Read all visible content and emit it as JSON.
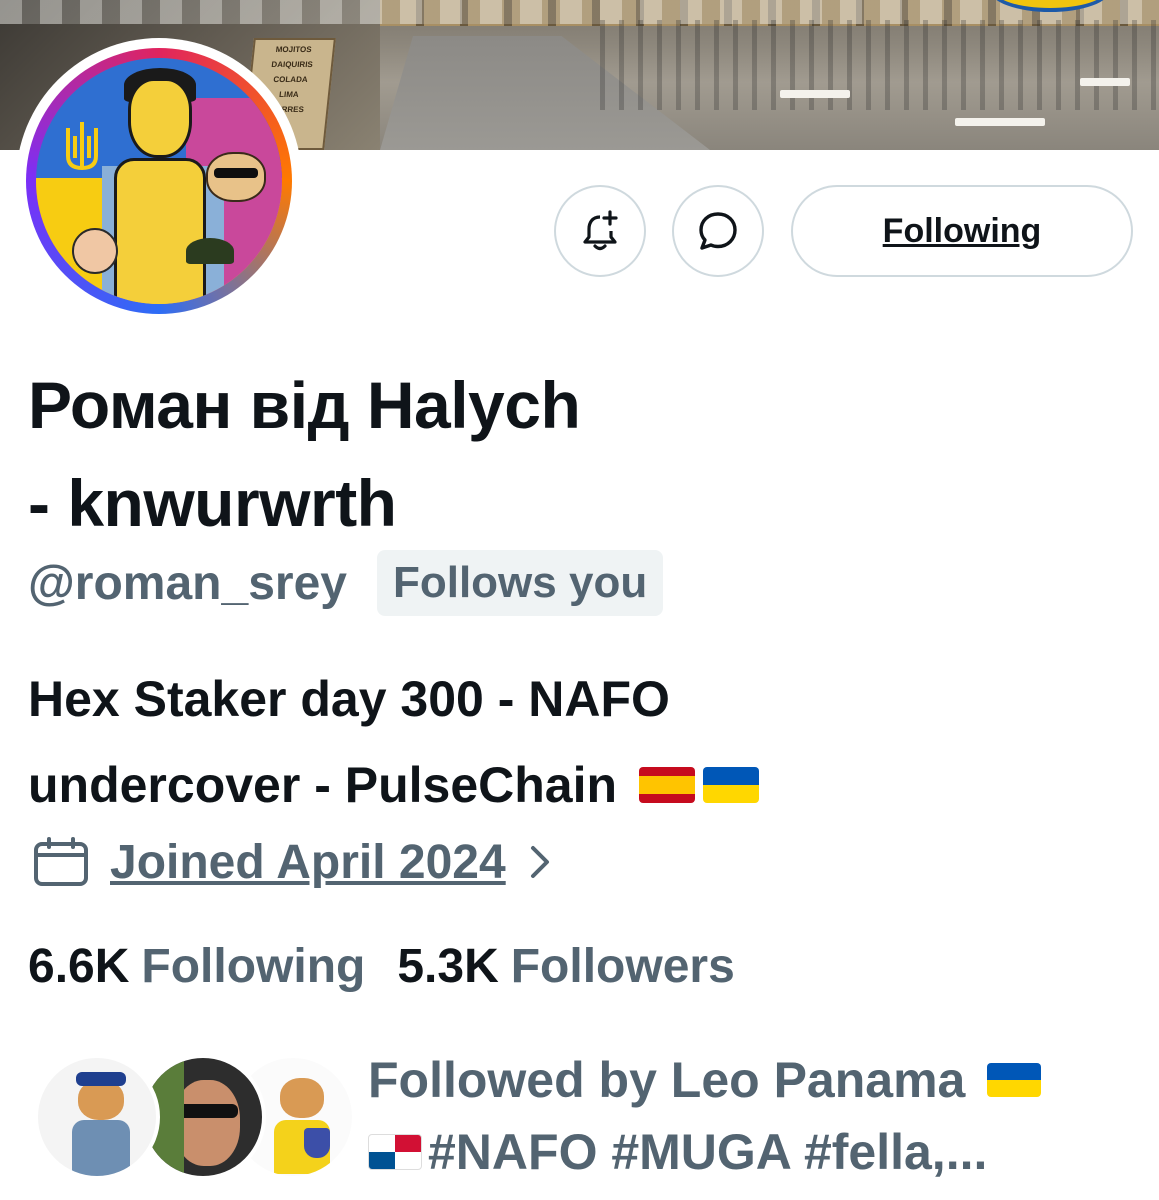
{
  "banner": {
    "sign_lines": [
      "MOJITOS",
      "DAIQUIRIS",
      "COLADA",
      "LIMA",
      "TURRES"
    ]
  },
  "actions": {
    "notify_icon": "bell-plus-icon",
    "message_icon": "message-bubble-icon",
    "following_label": "Following"
  },
  "profile": {
    "name_line1": "Роман від Halych",
    "name_line2": "- knwurwrth",
    "handle": "@roman_srey",
    "follows_you": "Follows you",
    "bio_line1": "Hex Staker day 300 - NAFO",
    "bio_line2": "undercover - PulseChain",
    "bio_flags": [
      "flag-spain",
      "flag-ukraine"
    ],
    "joined": "Joined April 2024"
  },
  "stats": {
    "following_count": "6.6K",
    "following_label": "Following",
    "followers_count": "5.3K",
    "followers_label": "Followers"
  },
  "followed_by": {
    "line1": "Followed by Leo Panama",
    "line2": "#NAFO #MUGA #fella,..."
  },
  "colors": {
    "text_primary": "#0f1419",
    "text_secondary": "#536471",
    "border": "#cfd9de",
    "pill_bg": "#eff3f4"
  }
}
